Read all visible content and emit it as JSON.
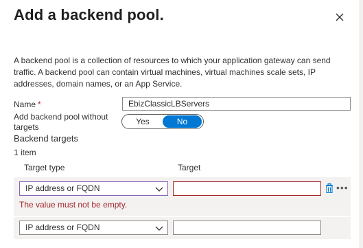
{
  "header": {
    "title": "Add a backend pool.",
    "close_icon": "close-icon"
  },
  "description": "A backend pool is a collection of resources to which your application gateway can send traffic. A backend pool can contain virtual machines, virtual machines scale sets, IP addresses, domain names, or an App Service.",
  "form": {
    "name_label": "Name",
    "name_required_marker": "*",
    "name_value": "EbizClassicLBServers",
    "without_targets_label": "Add backend pool without targets",
    "toggle": {
      "yes_label": "Yes",
      "no_label": "No",
      "selected": "No"
    }
  },
  "backend_targets": {
    "heading": "Backend targets",
    "count_text": "1 item",
    "columns": {
      "target_type": "Target type",
      "target": "Target"
    },
    "rows": [
      {
        "target_type": "IP address or FQDN",
        "target": "",
        "error": "The value must not be empty."
      },
      {
        "target_type": "IP address or FQDN",
        "target": ""
      }
    ]
  },
  "colors": {
    "accent": "#0078d4",
    "error": "#a4262c",
    "focus": "#8764b8",
    "row_background": "#f3f2f1"
  }
}
